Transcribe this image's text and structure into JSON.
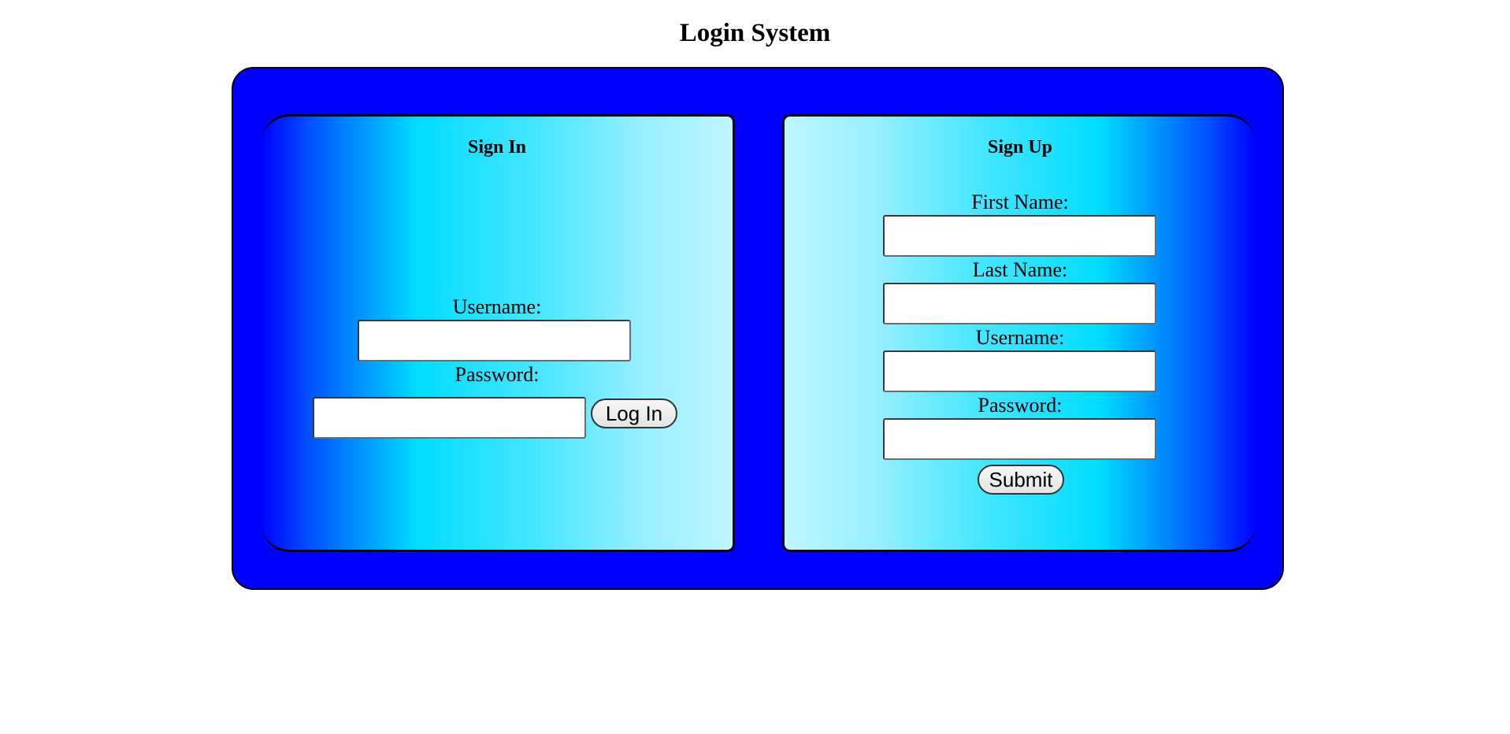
{
  "page": {
    "title": "Login System"
  },
  "signin": {
    "heading": "Sign In",
    "username_label": "Username:",
    "username_value": "",
    "password_label": "Password:",
    "password_value": "",
    "login_button": "Log In"
  },
  "signup": {
    "heading": "Sign Up",
    "first_name_label": "First Name:",
    "first_name_value": "",
    "last_name_label": "Last Name:",
    "last_name_value": "",
    "username_label": "Username:",
    "username_value": "",
    "password_label": "Password:",
    "password_value": "",
    "submit_button": "Submit"
  },
  "colors": {
    "outer_panel": "#0000ff",
    "gradient_light": "#bff6ff",
    "gradient_cyan": "#00ddff",
    "gradient_dark": "#0000ff"
  }
}
